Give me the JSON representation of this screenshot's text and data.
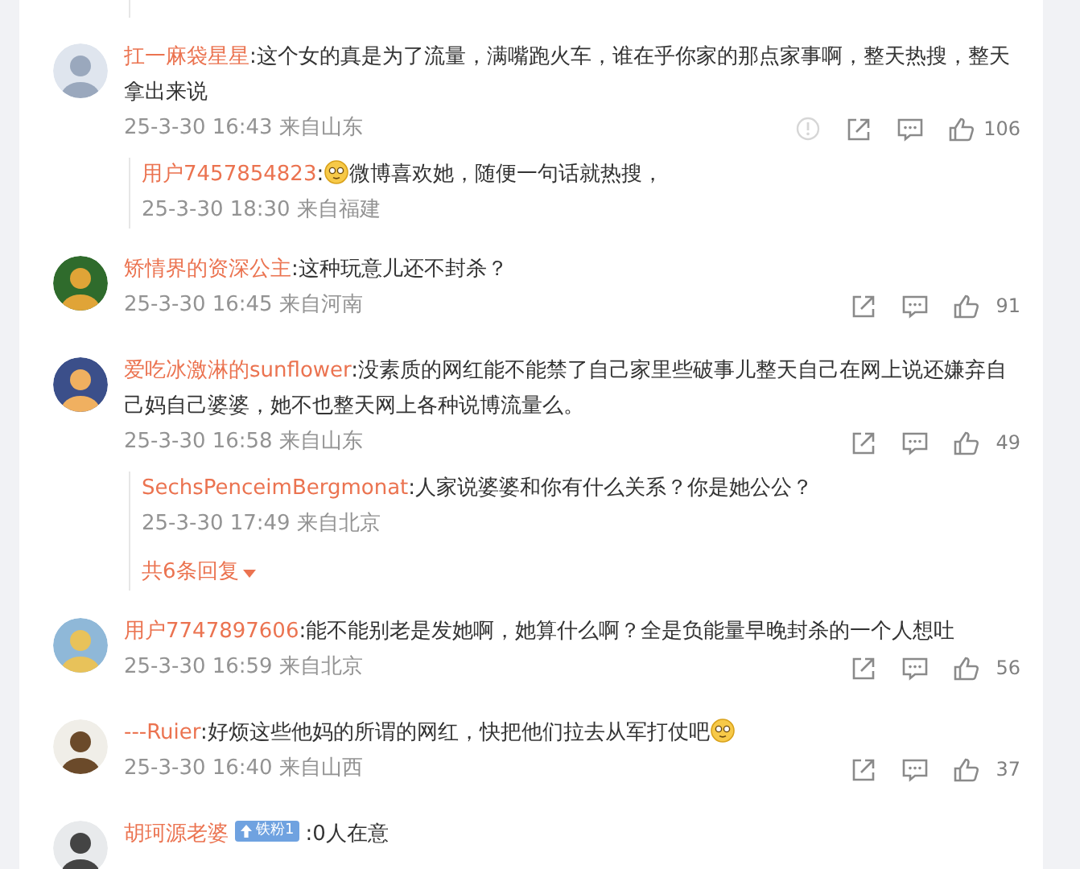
{
  "comments": [
    {
      "name": "扛一麻袋星星",
      "text": ":这个女的真是为了流量，满嘴跑火车，谁在乎你家的那点家事啊，整天热搜，整天拿出来说",
      "meta": "25-3-30 16:43 来自山东",
      "report": true,
      "likes": "106",
      "replies": [
        {
          "name": "用户7457854823",
          "lead": ":",
          "text": "微博喜欢她，随便一句话就热搜，",
          "emoji_lead": true,
          "meta": "25-3-30 18:30 来自福建"
        }
      ]
    },
    {
      "name": "矫情界的资深公主",
      "text": ":这种玩意儿还不封杀？",
      "meta": "25-3-30 16:45 来自河南",
      "report": false,
      "likes": "91"
    },
    {
      "name": "爱吃冰激淋的sunflower",
      "text": ":没素质的网红能不能禁了自己家里些破事儿整天自己在网上说还嫌弃自己妈自己婆婆，她不也整天网上各种说博流量么。",
      "meta": "25-3-30 16:58 来自山东",
      "report": false,
      "likes": "49",
      "replies": [
        {
          "name": "SechsPenceimBergmonat",
          "text": ":人家说婆婆和你有什么关系？你是她公公？",
          "meta": "25-3-30 17:49 来自北京"
        }
      ],
      "more": "共6条回复"
    },
    {
      "name": "用户7747897606",
      "text": ":能不能别老是发她啊，她算什么啊？全是负能量早晚封杀的一个人想吐",
      "meta": "25-3-30 16:59 来自北京",
      "report": false,
      "likes": "56"
    },
    {
      "name": "---Ruier",
      "text": ":好烦这些他妈的所谓的网红，快把他们拉去从军打仗吧",
      "emoji_end": true,
      "meta": "25-3-30 16:40 来自山西",
      "report": false,
      "likes": "37"
    },
    {
      "name": "胡珂源老婆",
      "badge": "铁粉1",
      "text": ":0人在意"
    }
  ]
}
